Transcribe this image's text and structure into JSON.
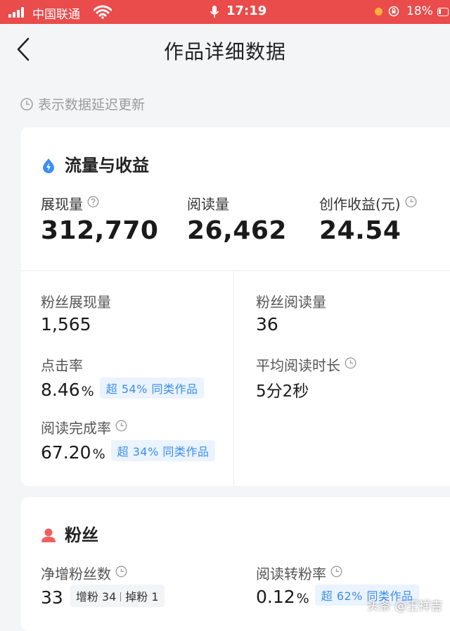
{
  "status_bar": {
    "carrier": "中国联通",
    "time": "17:19",
    "battery": "18%"
  },
  "nav": {
    "title": "作品详细数据"
  },
  "notice": "表示数据延迟更新",
  "traffic": {
    "title": "流量与收益",
    "impressions": {
      "label": "展现量",
      "value": "312,770"
    },
    "reads": {
      "label": "阅读量",
      "value": "26,462"
    },
    "earnings": {
      "label": "创作收益(元)",
      "value": "24.54"
    },
    "fan_impressions": {
      "label": "粉丝展现量",
      "value": "1,565"
    },
    "fan_reads": {
      "label": "粉丝阅读量",
      "value": "36"
    },
    "ctr": {
      "label": "点击率",
      "value": "8.46",
      "unit": "%",
      "badge": "超 54% 同类作品"
    },
    "avg_read_time": {
      "label": "平均阅读时长",
      "value": "5分2秒"
    },
    "completion": {
      "label": "阅读完成率",
      "value": "67.20",
      "unit": "%",
      "badge": "超 34% 同类作品"
    }
  },
  "fans": {
    "title": "粉丝",
    "net_gain": {
      "label": "净增粉丝数",
      "value": "33",
      "gain": "增粉 34",
      "loss": "掉粉 1"
    },
    "conversion": {
      "label": "阅读转粉率",
      "value": "0.12",
      "unit": "%",
      "badge": "超 62% 同类作品"
    }
  },
  "watermark": "头条 @王祥吉",
  "colors": {
    "status_bar": "#ea4b4b",
    "accent_blue": "#3b8ef0",
    "fan_icon": "#f0605f"
  }
}
